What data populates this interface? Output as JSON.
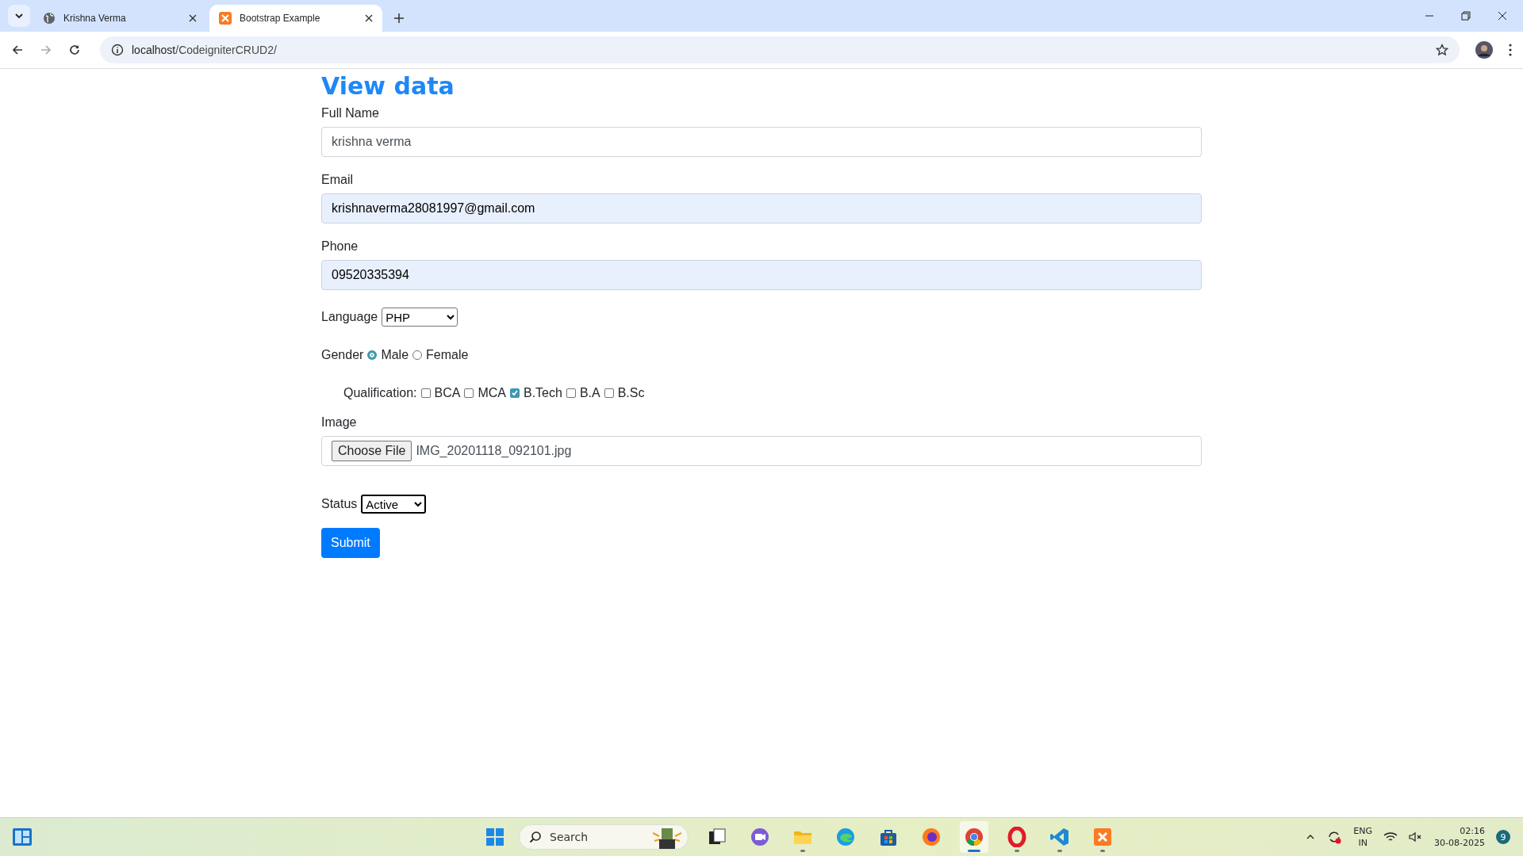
{
  "browser": {
    "tabs": [
      {
        "title": "Krishna Verma",
        "kind": "globe",
        "selected": false
      },
      {
        "title": "Bootstrap Example",
        "kind": "xampp",
        "selected": true
      }
    ],
    "url_host": "localhost",
    "url_path": "/CodeigniterCRUD2/"
  },
  "page": {
    "title": "View data",
    "fields": [
      {
        "label": "Full Name",
        "value": "krishna verma",
        "autofilled": false
      },
      {
        "label": "Email",
        "value": "krishnaverma28081997@gmail.com",
        "autofilled": true
      },
      {
        "label": "Phone",
        "value": "09520335394",
        "autofilled": true
      }
    ],
    "language": {
      "label": "Language",
      "value": "PHP"
    },
    "gender": {
      "label": "Gender",
      "options": [
        {
          "label": "Male",
          "selected": true
        },
        {
          "label": "Female",
          "selected": false
        }
      ]
    },
    "qualification": {
      "label": "Qualification:",
      "options": [
        {
          "label": "BCA",
          "checked": false
        },
        {
          "label": "MCA",
          "checked": false
        },
        {
          "label": "B.Tech",
          "checked": true
        },
        {
          "label": "B.A",
          "checked": false
        },
        {
          "label": "B.Sc",
          "checked": false
        }
      ]
    },
    "image": {
      "label": "Image",
      "button": "Choose File",
      "file": "IMG_20201118_092101.jpg"
    },
    "status": {
      "label": "Status",
      "value": "Active"
    },
    "submit": "Submit"
  },
  "taskbar": {
    "search_placeholder": "Search",
    "apps": [
      {
        "kind": "taskview",
        "running": false,
        "selected": false
      },
      {
        "kind": "chat",
        "running": false,
        "selected": false
      },
      {
        "kind": "folder",
        "running": true,
        "selected": false
      },
      {
        "kind": "edge",
        "running": false,
        "selected": false
      },
      {
        "kind": "store",
        "running": false,
        "selected": false
      },
      {
        "kind": "firefox",
        "running": false,
        "selected": false
      },
      {
        "kind": "chrome",
        "running": true,
        "selected": true
      },
      {
        "kind": "opera",
        "running": true,
        "selected": false
      },
      {
        "kind": "vscode",
        "running": true,
        "selected": false
      },
      {
        "kind": "xampp",
        "running": true,
        "selected": false
      }
    ],
    "language": "ENG",
    "region": "IN",
    "time": "02:16",
    "date": "30-08-2025",
    "notifications": "9"
  }
}
